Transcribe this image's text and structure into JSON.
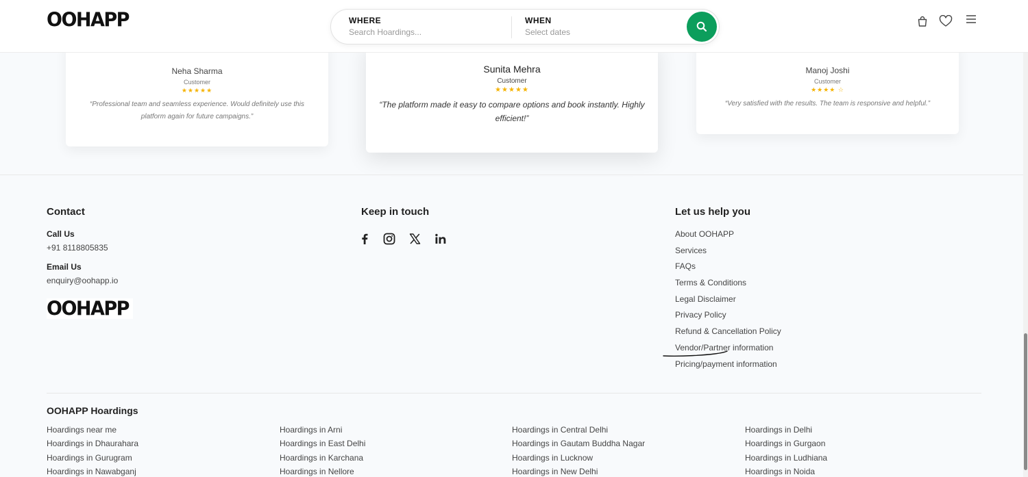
{
  "header": {
    "logo": "OOHAPP",
    "search": {
      "where_label": "WHERE",
      "where_placeholder": "Search Hoardings...",
      "when_label": "WHEN",
      "when_placeholder": "Select dates"
    },
    "icons": [
      "shopping-bag-icon",
      "heart-icon",
      "menu-icon"
    ],
    "accent": "#0c9e5c"
  },
  "testimonials": [
    {
      "name": "Neha Sharma",
      "role": "Customer",
      "stars": "★★★★★",
      "quote": "“Professional team and seamless experience. Would definitely use this platform again for future campaigns.”"
    },
    {
      "name": "Sunita Mehra",
      "role": "Customer",
      "stars": "★★★★★",
      "quote": "“The platform made it easy to compare options and book instantly. Highly efficient!”"
    },
    {
      "name": "Manoj Joshi",
      "role": "Customer",
      "stars": "★★★★ ☆",
      "quote": "“Very satisfied with the results. The team is responsive and helpful.”"
    }
  ],
  "footer": {
    "contact": {
      "heading": "Contact",
      "call_label": "Call Us",
      "phone": "+91 8118805835",
      "email_label": "Email Us",
      "email": "enquiry@oohapp.io",
      "logo": "OOHAPP"
    },
    "social": {
      "heading": "Keep in touch",
      "icons": [
        "facebook-icon",
        "instagram-icon",
        "x-icon",
        "linkedin-icon"
      ]
    },
    "help": {
      "heading": "Let us help you",
      "links": [
        "About OOHAPP",
        "Services",
        "FAQs",
        "Terms & Conditions",
        "Legal Disclaimer",
        "Privacy Policy",
        "Refund & Cancellation Policy",
        "Vendor/Partner information",
        "Pricing/payment information"
      ]
    },
    "hoardings": {
      "heading": "OOHAPP Hoardings",
      "columns": [
        [
          "Hoardings near me",
          "Hoardings in Dhaurahara",
          "Hoardings in Gurugram",
          "Hoardings in Nawabganj"
        ],
        [
          "Hoardings in Arni",
          "Hoardings in East Delhi",
          "Hoardings in Karchana",
          "Hoardings in Nellore"
        ],
        [
          "Hoardings in Central Delhi",
          "Hoardings in Gautam Buddha Nagar",
          "Hoardings in Lucknow",
          "Hoardings in New Delhi"
        ],
        [
          "Hoardings in Delhi",
          "Hoardings in Gurgaon",
          "Hoardings in Ludhiana",
          "Hoardings in Noida"
        ]
      ]
    }
  }
}
